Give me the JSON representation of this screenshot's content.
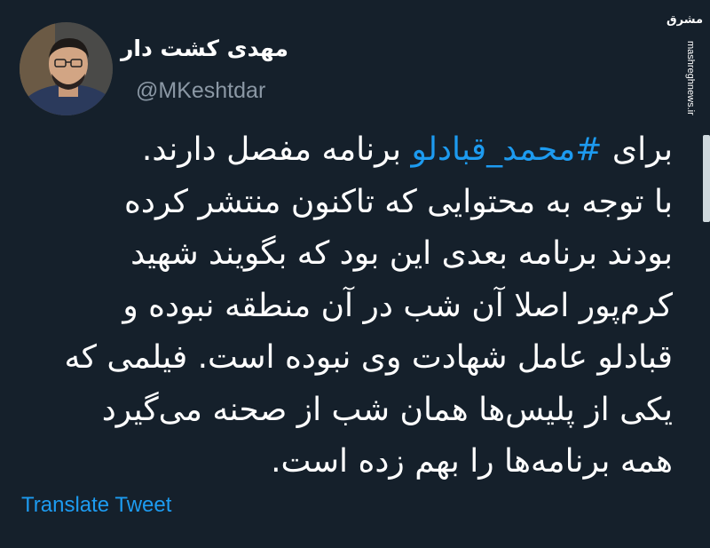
{
  "profile": {
    "display_name": "مهدی کشت دار",
    "handle": "@MKeshtdar"
  },
  "tweet": {
    "line1_before": "برای ",
    "hashtag": "#محمد_قبادلو",
    "line1_after": " برنامه مفصل دارند.",
    "lines": [
      "با توجه به محتوایی که تاکنون منتشر کرده",
      "بودند برنامه بعدی این بود که بگویند شهید",
      "کرم‌پور اصلا آن شب در آن منطقه نبوده و",
      "قبادلو عامل شهادت وی نبوده است. فیلمی که",
      "یکی از پلیس‌ها همان شب از صحنه می‌گیرد",
      "همه برنامه‌ها را بهم زده است."
    ]
  },
  "actions": {
    "translate_label": "Translate Tweet"
  },
  "watermark": {
    "logo": "مشرق",
    "url": "mashreghnews.ir"
  },
  "colors": {
    "background": "#15202b",
    "text": "#ffffff",
    "secondary_text": "#8b98a5",
    "link": "#1d9bf0"
  }
}
